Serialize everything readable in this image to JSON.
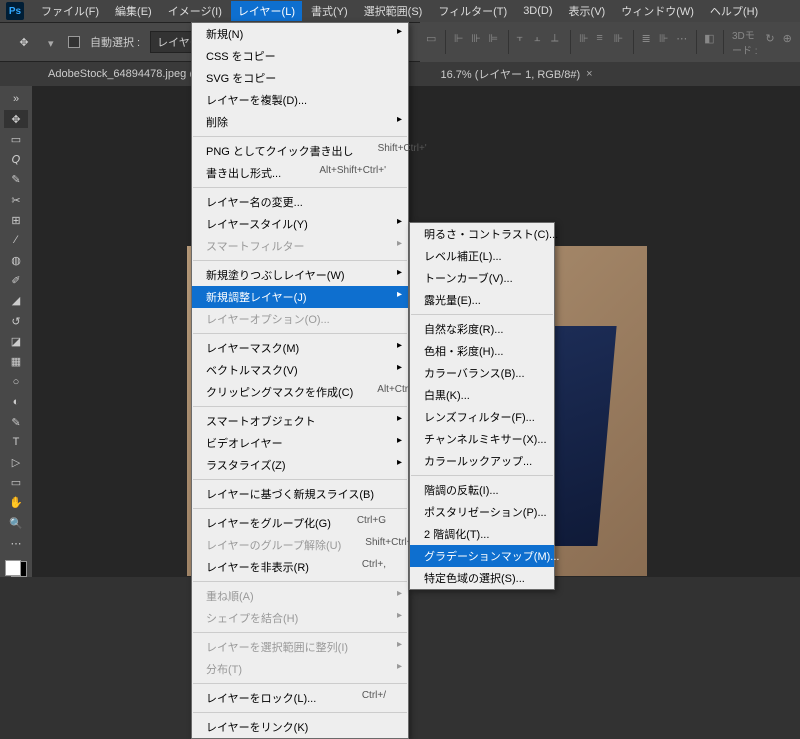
{
  "menubar": {
    "items": [
      "ファイル(F)",
      "編集(E)",
      "イメージ(I)",
      "レイヤー(L)",
      "書式(Y)",
      "選択範囲(S)",
      "フィルター(T)",
      "3D(D)",
      "表示(V)",
      "ウィンドウ(W)",
      "ヘルプ(H)"
    ],
    "active_index": 3
  },
  "options": {
    "auto_select": "自動選択 :",
    "layer_label": "レイヤー",
    "mode_3d": "3Dモード :"
  },
  "doc_tabs": {
    "tab1": "AdobeStock_64894478.jpeg @",
    "tab2": "16.7% (レイヤー 1, RGB/8#)"
  },
  "layer_menu": {
    "group1": [
      {
        "label": "新規(N)",
        "arrow": true
      },
      {
        "label": "CSS をコピー"
      },
      {
        "label": "SVG をコピー"
      },
      {
        "label": "レイヤーを複製(D)..."
      },
      {
        "label": "削除",
        "arrow": true
      }
    ],
    "group2": [
      {
        "label": "PNG としてクイック書き出し",
        "shortcut": "Shift+Ctrl+'"
      },
      {
        "label": "書き出し形式...",
        "shortcut": "Alt+Shift+Ctrl+'"
      }
    ],
    "group3": [
      {
        "label": "レイヤー名の変更..."
      },
      {
        "label": "レイヤースタイル(Y)",
        "arrow": true
      },
      {
        "label": "スマートフィルター",
        "arrow": true,
        "disabled": true
      }
    ],
    "group4": [
      {
        "label": "新規塗りつぶしレイヤー(W)",
        "arrow": true
      },
      {
        "label": "新規調整レイヤー(J)",
        "arrow": true,
        "highlight": true
      },
      {
        "label": "レイヤーオプション(O)...",
        "disabled": true
      }
    ],
    "group5": [
      {
        "label": "レイヤーマスク(M)",
        "arrow": true
      },
      {
        "label": "ベクトルマスク(V)",
        "arrow": true
      },
      {
        "label": "クリッピングマスクを作成(C)",
        "shortcut": "Alt+Ctrl+G"
      }
    ],
    "group6": [
      {
        "label": "スマートオブジェクト",
        "arrow": true
      },
      {
        "label": "ビデオレイヤー",
        "arrow": true
      },
      {
        "label": "ラスタライズ(Z)",
        "arrow": true
      }
    ],
    "group7": [
      {
        "label": "レイヤーに基づく新規スライス(B)"
      }
    ],
    "group8": [
      {
        "label": "レイヤーをグループ化(G)",
        "shortcut": "Ctrl+G"
      },
      {
        "label": "レイヤーのグループ解除(U)",
        "shortcut": "Shift+Ctrl+G",
        "disabled": true
      },
      {
        "label": "レイヤーを非表示(R)",
        "shortcut": "Ctrl+,"
      }
    ],
    "group9": [
      {
        "label": "重ね順(A)",
        "arrow": true,
        "disabled": true
      },
      {
        "label": "シェイプを結合(H)",
        "arrow": true,
        "disabled": true
      }
    ],
    "group10": [
      {
        "label": "レイヤーを選択範囲に整列(I)",
        "arrow": true,
        "disabled": true
      },
      {
        "label": "分布(T)",
        "arrow": true,
        "disabled": true
      }
    ],
    "group11": [
      {
        "label": "レイヤーをロック(L)...",
        "shortcut": "Ctrl+/"
      }
    ],
    "group12": [
      {
        "label": "レイヤーをリンク(K)"
      }
    ]
  },
  "adjustment_menu": {
    "g1": [
      "明るさ・コントラスト(C)...",
      "レベル補正(L)...",
      "トーンカーブ(V)...",
      "露光量(E)..."
    ],
    "g2": [
      "自然な彩度(R)...",
      "色相・彩度(H)...",
      "カラーバランス(B)...",
      "白黒(K)...",
      "レンズフィルター(F)...",
      "チャンネルミキサー(X)...",
      "カラールックアップ..."
    ],
    "g3": [
      "階調の反転(I)...",
      "ポスタリゼーション(P)...",
      "2 階調化(T)..."
    ],
    "g3_hl": "グラデーションマップ(M)...",
    "g3_last": "特定色域の選択(S)..."
  },
  "tools": [
    "move",
    "marquee",
    "lasso",
    "wand",
    "crop",
    "eyedropper",
    "heal",
    "brush",
    "stamp",
    "history",
    "eraser",
    "gradient",
    "blur",
    "dodge",
    "pen",
    "type",
    "path",
    "rect",
    "hand",
    "zoom",
    "more"
  ]
}
